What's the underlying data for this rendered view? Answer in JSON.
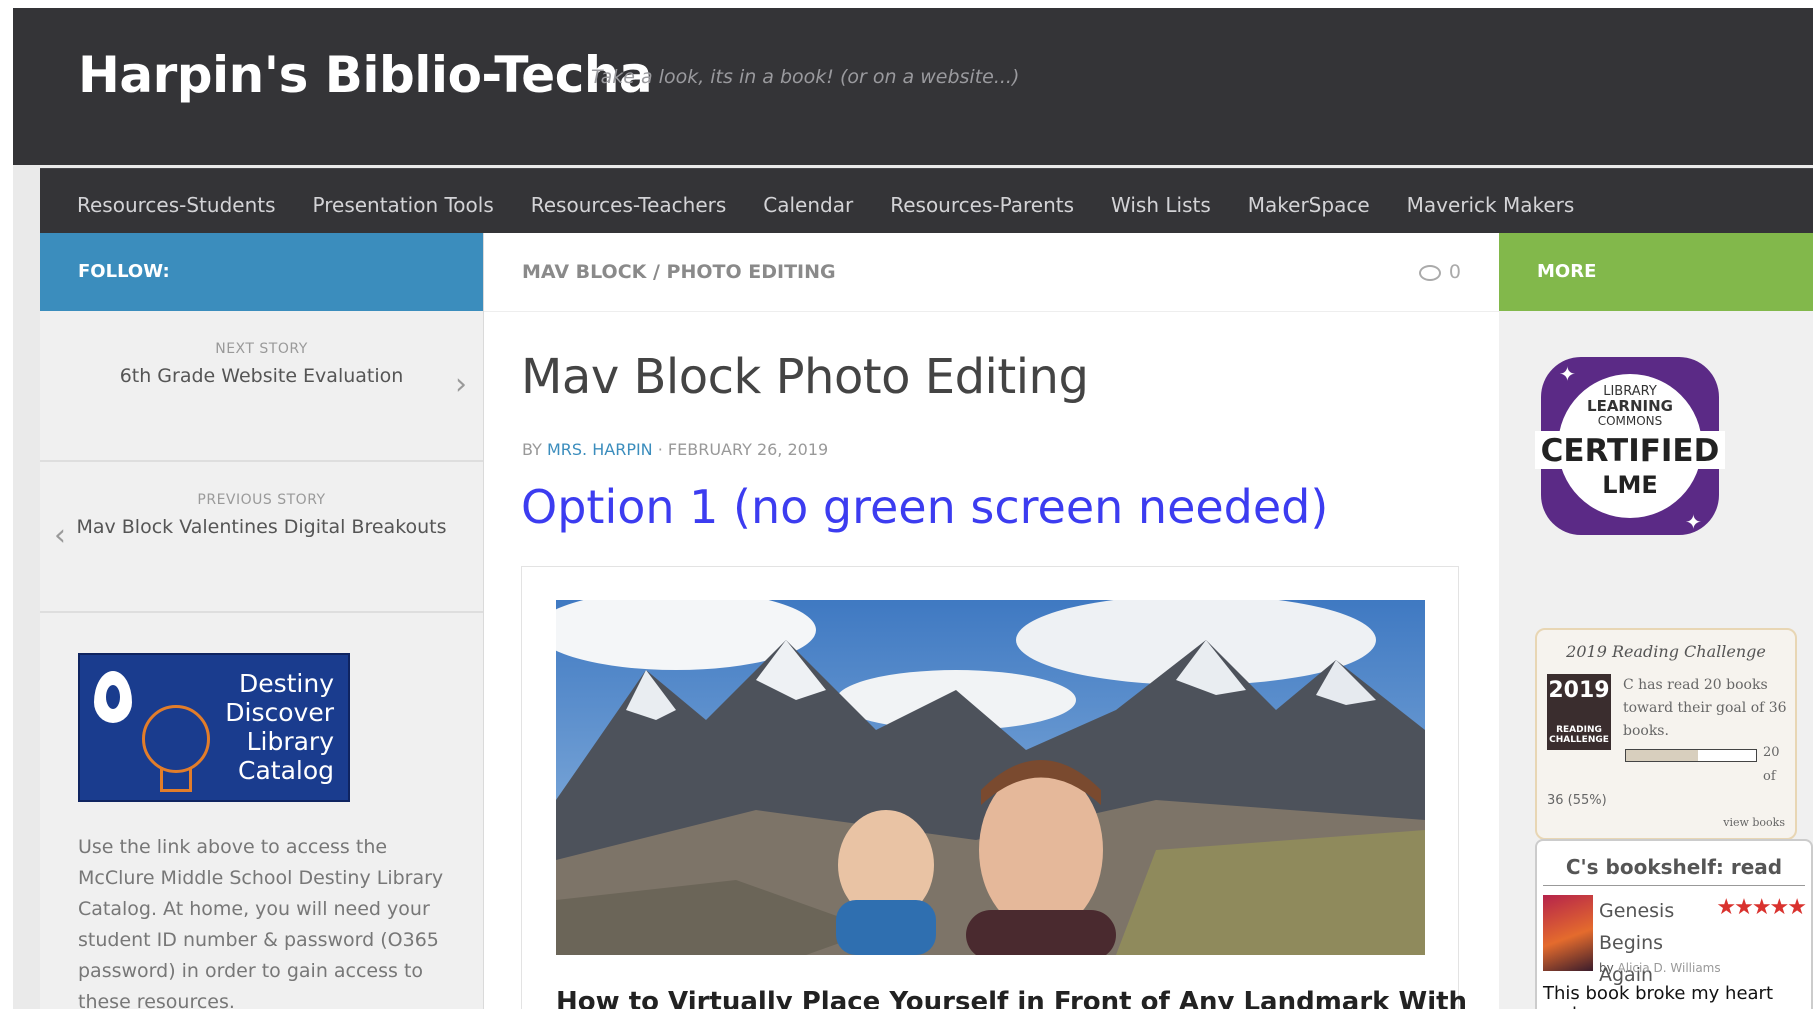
{
  "header": {
    "site_title": "Harpin's Biblio-Techa",
    "tagline": "Take a look, its in a book! (or on a website...)"
  },
  "nav": {
    "items": [
      "Resources-Students",
      "Presentation Tools",
      "Resources-Teachers",
      "Calendar",
      "Resources-Parents",
      "Wish Lists",
      "MakerSpace",
      "Maverick Makers"
    ]
  },
  "sidebar_left": {
    "follow_label": "FOLLOW:",
    "next_story": {
      "label": "NEXT STORY",
      "title": "6th Grade Website Evaluation"
    },
    "previous_story": {
      "label": "PREVIOUS STORY",
      "title": "Mav Block Valentines Digital Breakouts"
    },
    "destiny_text": [
      "Destiny",
      "Discover",
      "Library",
      "Catalog"
    ],
    "description": "Use the link above to access the McClure Middle School Destiny Library Catalog. At home, you will need your student ID number & password (O365 password) in order to gain access to these resources."
  },
  "main": {
    "breadcrumb": "MAV BLOCK / PHOTO EDITING",
    "comment_count": "0",
    "post_title": "Mav Block Photo Editing",
    "byline": {
      "by": "BY",
      "author": "MRS. HARPIN",
      "date": "· FEBRUARY 26, 2019"
    },
    "option_heading": "Option 1 (no green screen needed)",
    "embed_title": "How to Virtually Place Yourself in Front of Any Landmark With"
  },
  "sidebar_right": {
    "more_label": "MORE",
    "badge": {
      "line1": "LIBRARY",
      "line2": "LEARNING",
      "line3": "COMMONS",
      "certified": "CERTIFIED",
      "abbr": "LME"
    },
    "reading_challenge": {
      "heading": "2019 Reading Challenge",
      "cover_year": "2019",
      "cover_label1": "READING",
      "cover_label2": "CHALLENGE",
      "description": "C has read 20 books toward their goal of 36 books.",
      "count": "20",
      "of": "of",
      "total": "36 (55%)",
      "progress": 0.55,
      "view_link": "view books"
    },
    "bookshelf": {
      "heading": "C's bookshelf: read",
      "book_title": "Genesis Begins Again",
      "stars": "★★★★★",
      "rating": 5,
      "by": "by",
      "author": "Alicia D. Williams",
      "review": "This book broke my heart and"
    }
  },
  "colors": {
    "header_bg": "#343437",
    "follow_bg": "#3b8dbd",
    "more_bg": "#82b84b",
    "link_blue": "#3b8dbd",
    "option_blue": "#3c3cf0",
    "star_red": "#d9322e",
    "badge_purple": "#5b2a86"
  },
  "icons": [
    "comment-icon",
    "chevron-right-icon",
    "chevron-left-icon",
    "destiny-logo-icon",
    "lightbulb-icon"
  ]
}
